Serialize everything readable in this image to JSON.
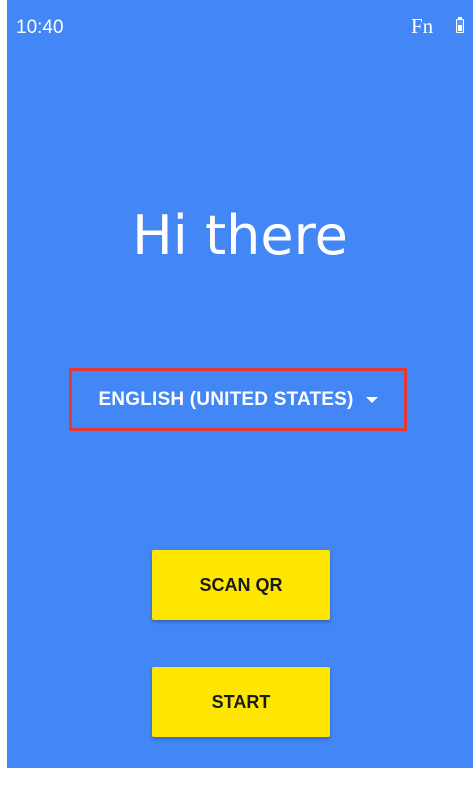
{
  "status_bar": {
    "time": "10:40",
    "fn_label": "Fn",
    "battery_icon": "battery-icon"
  },
  "main": {
    "greeting": "Hi there",
    "language": {
      "selected": "ENGLISH (UNITED STATES)",
      "icon": "arrow-drop-down-icon"
    },
    "buttons": {
      "scan_qr": "SCAN QR",
      "start": "START"
    }
  },
  "colors": {
    "background": "#4287f5",
    "button": "#ffe600",
    "highlight_border": "#e53935",
    "text_light": "#ffffff"
  }
}
